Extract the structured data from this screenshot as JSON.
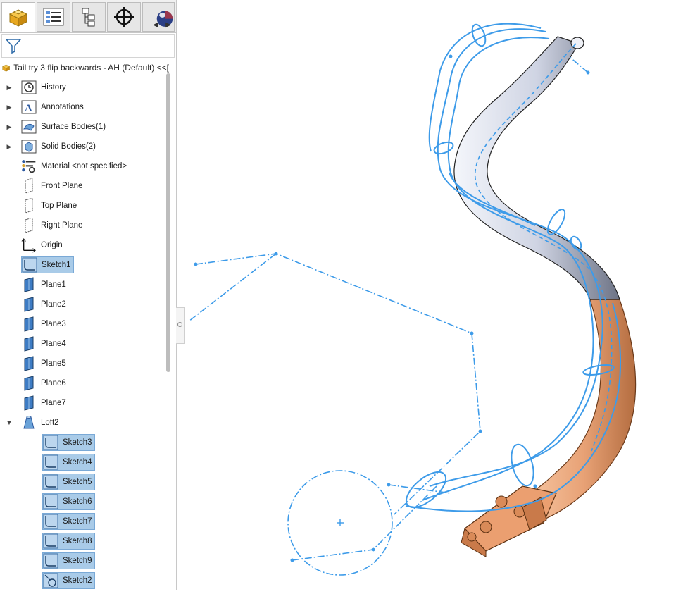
{
  "document": {
    "title": "Tail try 3 flip backwards - AH (Default) <<["
  },
  "tabs": [
    {
      "name": "feature-manager-tab",
      "icon": "part-icon"
    },
    {
      "name": "property-manager-tab",
      "icon": "property-list-icon"
    },
    {
      "name": "configuration-manager-tab",
      "icon": "configuration-icon"
    },
    {
      "name": "dimxpert-manager-tab",
      "icon": "crosshair-icon"
    },
    {
      "name": "display-manager-tab",
      "icon": "appearance-sphere-icon"
    }
  ],
  "tree": [
    {
      "label": "History",
      "icon": "history-icon",
      "expander": "right",
      "selected": false
    },
    {
      "label": "Annotations",
      "icon": "annotations-icon",
      "expander": "right",
      "selected": false
    },
    {
      "label": "Surface Bodies(1)",
      "icon": "surface-bodies-icon",
      "expander": "right",
      "selected": false
    },
    {
      "label": "Solid Bodies(2)",
      "icon": "solid-bodies-icon",
      "expander": "right",
      "selected": false
    },
    {
      "label": "Material <not specified>",
      "icon": "material-icon",
      "expander": "",
      "selected": false
    },
    {
      "label": "Front Plane",
      "icon": "plane-icon",
      "expander": "",
      "selected": false
    },
    {
      "label": "Top Plane",
      "icon": "plane-icon",
      "expander": "",
      "selected": false
    },
    {
      "label": "Right Plane",
      "icon": "plane-icon",
      "expander": "",
      "selected": false
    },
    {
      "label": "Origin",
      "icon": "origin-icon",
      "expander": "",
      "selected": false
    },
    {
      "label": "Sketch1",
      "icon": "sketch-icon",
      "expander": "",
      "selected": true
    },
    {
      "label": "Plane1",
      "icon": "ref-plane-icon",
      "expander": "",
      "selected": false
    },
    {
      "label": "Plane2",
      "icon": "ref-plane-icon",
      "expander": "",
      "selected": false
    },
    {
      "label": "Plane3",
      "icon": "ref-plane-icon",
      "expander": "",
      "selected": false
    },
    {
      "label": "Plane4",
      "icon": "ref-plane-icon",
      "expander": "",
      "selected": false
    },
    {
      "label": "Plane5",
      "icon": "ref-plane-icon",
      "expander": "",
      "selected": false
    },
    {
      "label": "Plane6",
      "icon": "ref-plane-icon",
      "expander": "",
      "selected": false
    },
    {
      "label": "Plane7",
      "icon": "ref-plane-icon",
      "expander": "",
      "selected": false
    },
    {
      "label": "Loft2",
      "icon": "loft-icon",
      "expander": "down",
      "selected": false
    },
    {
      "label": "Sketch3",
      "icon": "sketch-icon",
      "expander": "",
      "selected": true,
      "child": true
    },
    {
      "label": "Sketch4",
      "icon": "sketch-icon",
      "expander": "",
      "selected": true,
      "child": true
    },
    {
      "label": "Sketch5",
      "icon": "sketch-icon",
      "expander": "",
      "selected": true,
      "child": true
    },
    {
      "label": "Sketch6",
      "icon": "sketch-icon",
      "expander": "",
      "selected": true,
      "child": true
    },
    {
      "label": "Sketch7",
      "icon": "sketch-icon",
      "expander": "",
      "selected": true,
      "child": true
    },
    {
      "label": "Sketch8",
      "icon": "sketch-icon",
      "expander": "",
      "selected": true,
      "child": true
    },
    {
      "label": "Sketch9",
      "icon": "sketch-icon",
      "expander": "",
      "selected": true,
      "child": true
    },
    {
      "label": "Sketch2",
      "icon": "sketch-circle-icon",
      "expander": "",
      "selected": true,
      "child": true
    }
  ],
  "colors": {
    "sketch_line": "#3d9be9",
    "selection_fill": "#a9cbe8",
    "model_copper": "#e8a276",
    "model_silver": "#dfe3ee"
  }
}
